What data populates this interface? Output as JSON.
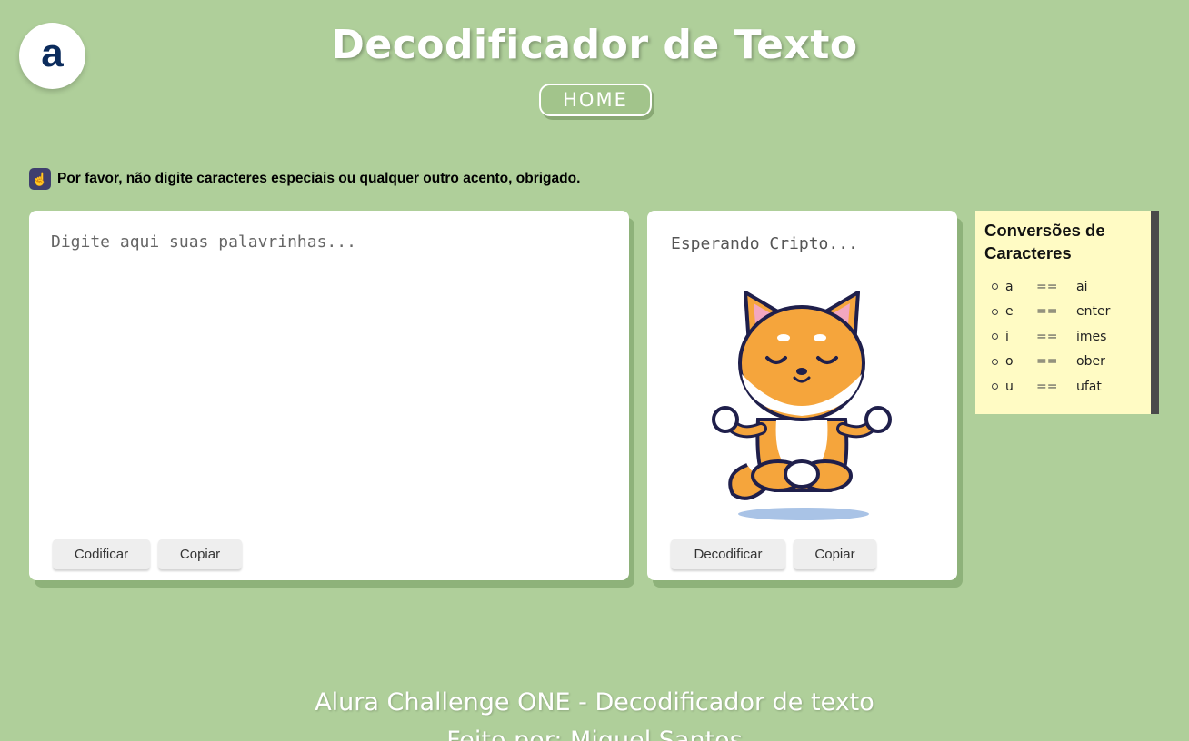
{
  "header": {
    "logo_letter": "a",
    "title": "Decodificador de Texto",
    "home_label": "HOME"
  },
  "notice": {
    "icon": "hand-pointer-icon",
    "text": "Por favor, não digite caracteres especiais ou qualquer outro acento, obrigado."
  },
  "input_panel": {
    "placeholder": "Digite aqui suas palavrinhas...",
    "value": "",
    "encode_label": "Codificar",
    "copy_label": "Copiar"
  },
  "output_panel": {
    "text": "Esperando Cripto...",
    "image": "meditating-shiba-dog",
    "decode_label": "Decodificar",
    "copy_label": "Copiar"
  },
  "conversions": {
    "title": "Conversões de Caracteres",
    "items": [
      {
        "from": "a",
        "eq": "==",
        "to": "ai"
      },
      {
        "from": "e",
        "eq": "==",
        "to": "enter"
      },
      {
        "from": "i",
        "eq": "==",
        "to": "imes"
      },
      {
        "from": "o",
        "eq": "==",
        "to": "ober"
      },
      {
        "from": "u",
        "eq": "==",
        "to": "ufat"
      }
    ]
  },
  "footer": {
    "line1": "Alura Challenge ONE - Decodificador de texto",
    "line2": "Feito por: Miguel Santos"
  },
  "colors": {
    "background": "#afcf9a",
    "sticky_note": "#fffbc4",
    "logo_text": "#0b2b5c"
  }
}
